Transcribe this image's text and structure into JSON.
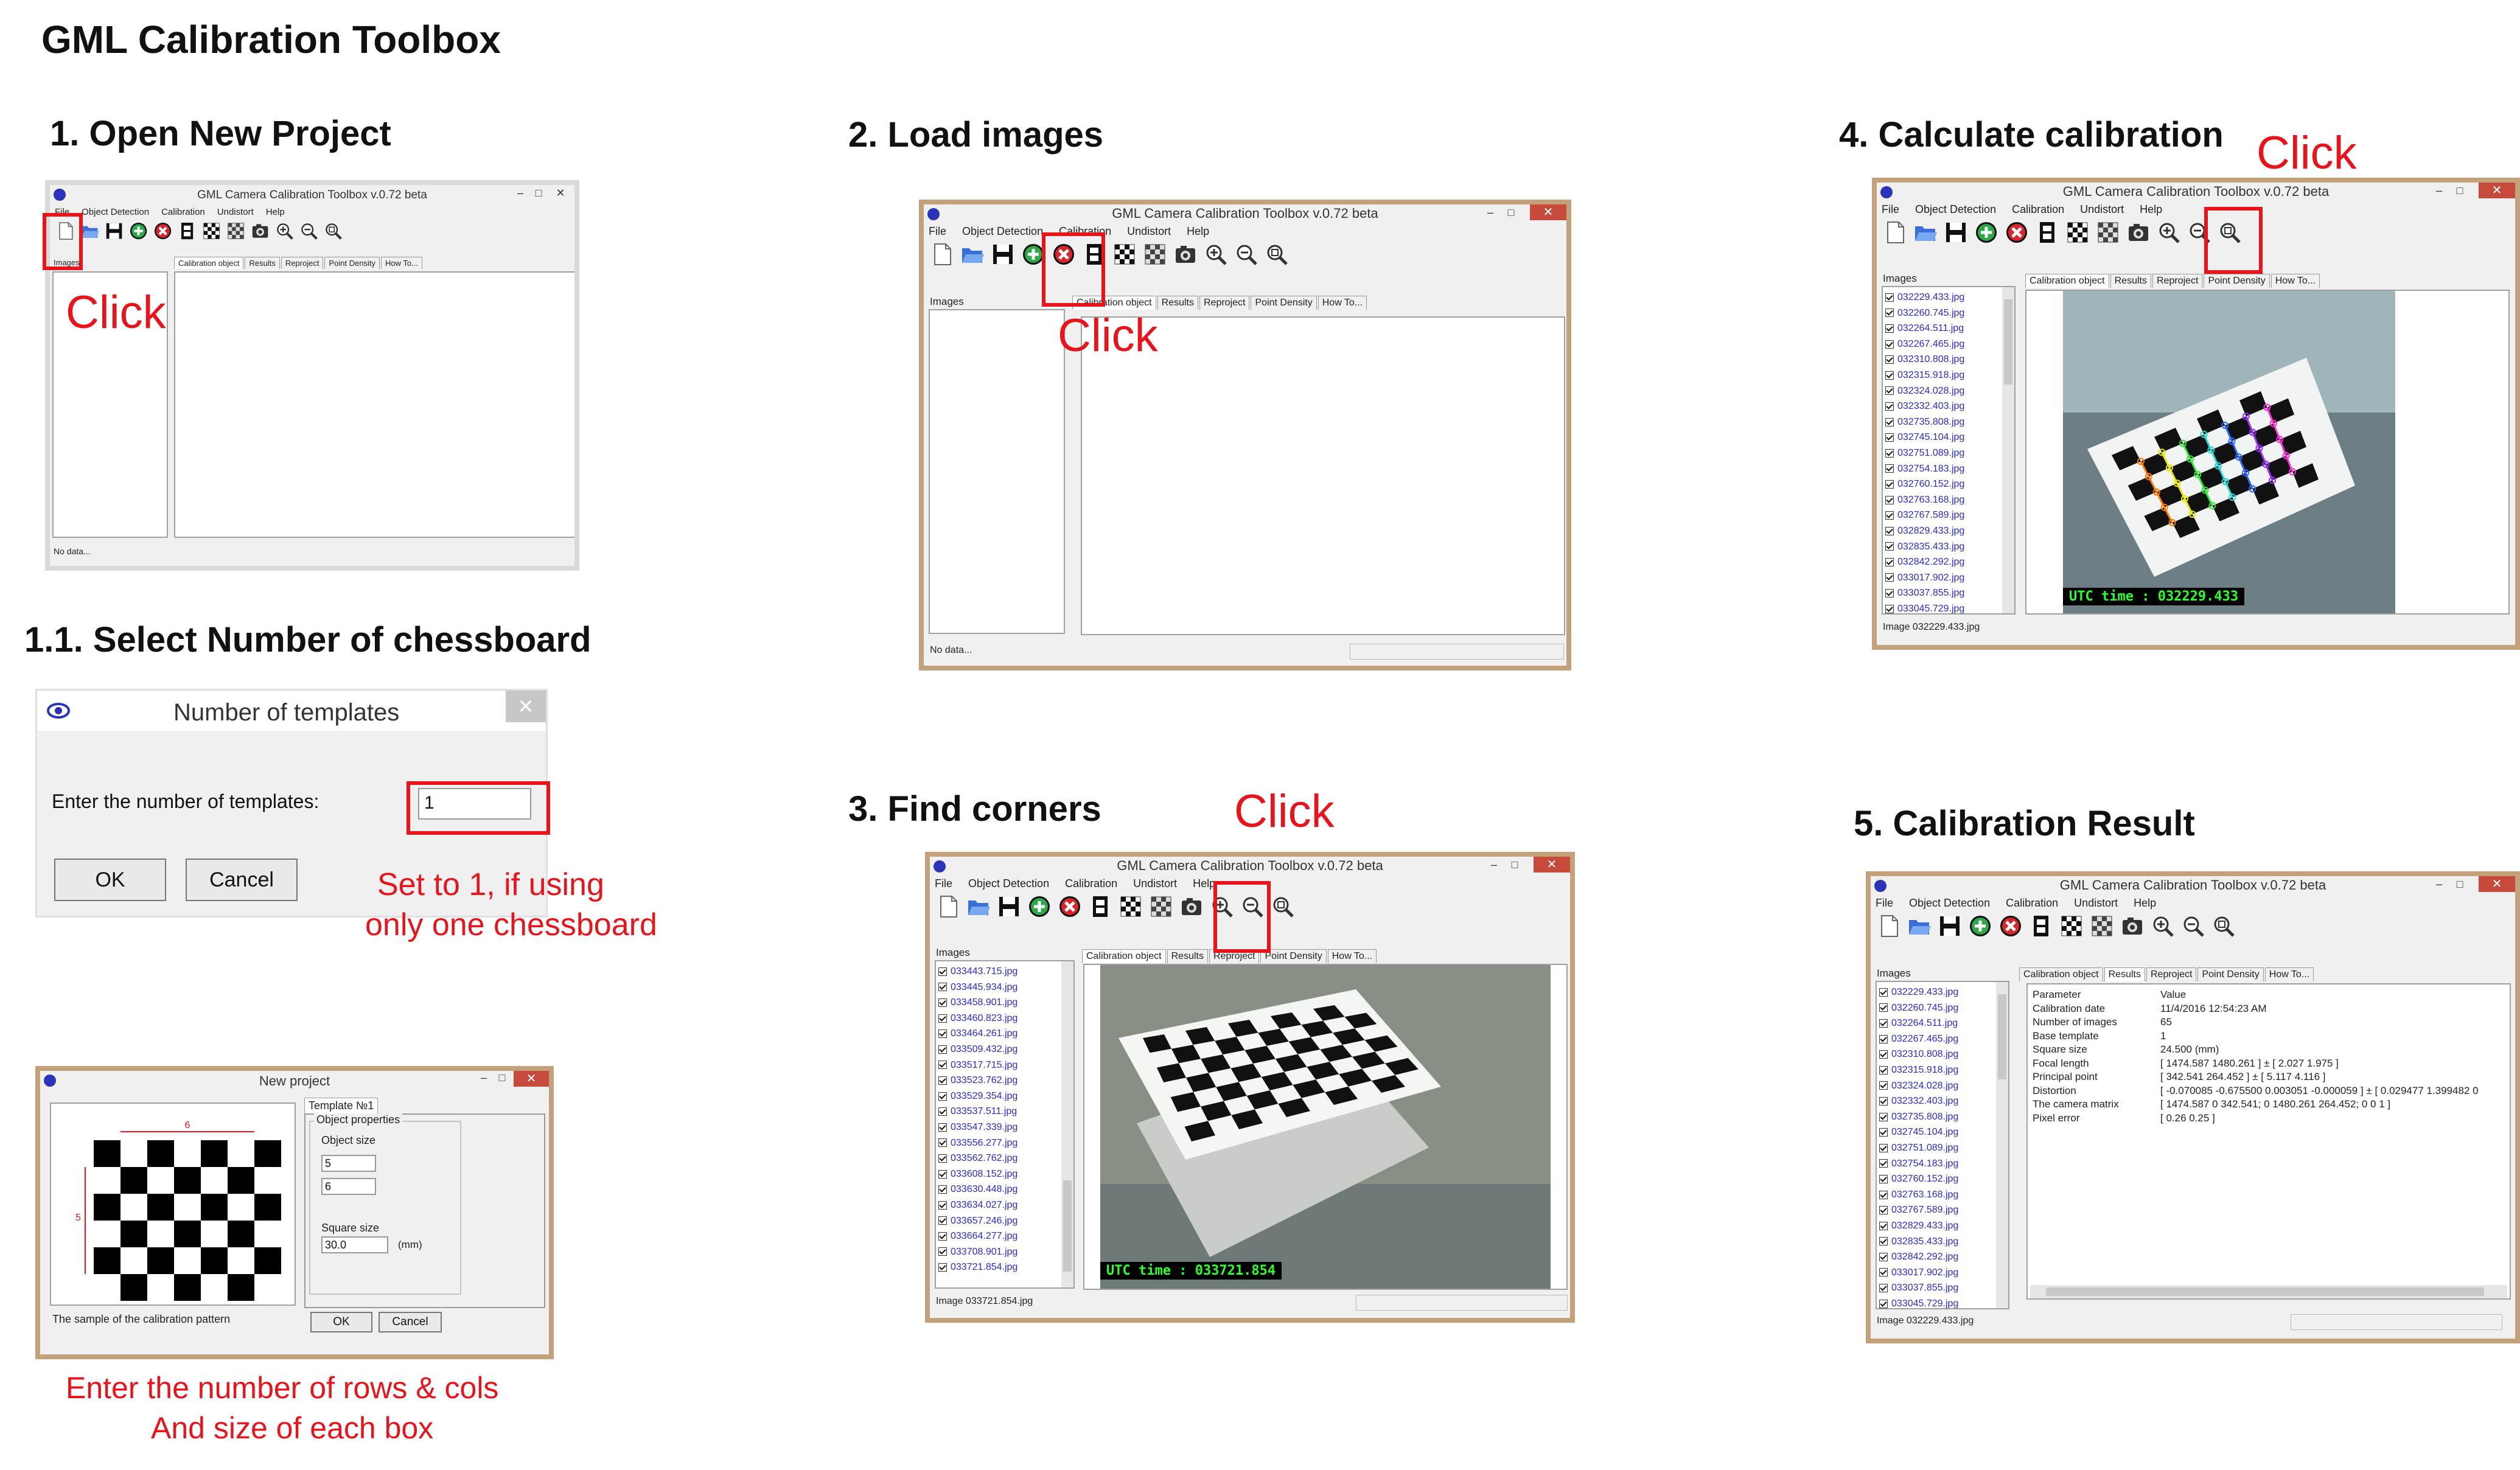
{
  "page_title": "GML Calibration Toolbox",
  "app": {
    "window_title": "GML Camera Calibration Toolbox  v.0.72 beta",
    "menu": [
      "File",
      "Object Detection",
      "Calibration",
      "Undistort",
      "Help"
    ],
    "tabs": [
      "Calibration object",
      "Results",
      "Reproject",
      "Point Density",
      "How To..."
    ],
    "images_label": "Images",
    "no_data": "No data..."
  },
  "toolbar_icons": [
    "new-file-icon",
    "open-folder-icon",
    "save-icon",
    "add-images-icon",
    "remove-images-icon",
    "film-icon",
    "chessboard-icon",
    "detect-corners-icon",
    "camera-calibrate-icon",
    "zoom-in-icon",
    "zoom-out-icon",
    "zoom-fit-icon"
  ],
  "step1": {
    "heading": "1. Open New Project",
    "click": "Click"
  },
  "step1_1": {
    "heading": "1.1. Select Number of chessboard",
    "dialog_title": "Number of templates",
    "prompt": "Enter the number of templates:",
    "value": "1",
    "ok": "OK",
    "cancel": "Cancel",
    "note_line1": "Set to 1, if using",
    "note_line2": "only one chessboard"
  },
  "new_project": {
    "title": "New project",
    "tab": "Template №1",
    "group": "Object properties",
    "object_size_label": "Object size",
    "rows": "5",
    "cols": "6",
    "square_size_label": "Square size",
    "square_size": "30.0",
    "unit": "(mm)",
    "sample_label": "The sample of the calibration pattern",
    "ok": "OK",
    "cancel": "Cancel",
    "dim_top": "6",
    "dim_left": "5",
    "dim_square": "30",
    "note_line1": "Enter the number of rows & cols",
    "note_line2": "And size of each box"
  },
  "step2": {
    "heading": "2. Load images",
    "click": "Click"
  },
  "step3": {
    "heading": "3. Find corners",
    "click": "Click",
    "files": [
      "033443.715.jpg",
      "033445.934.jpg",
      "033458.901.jpg",
      "033460.823.jpg",
      "033464.261.jpg",
      "033509.432.jpg",
      "033517.715.jpg",
      "033523.762.jpg",
      "033529.354.jpg",
      "033537.511.jpg",
      "033547.339.jpg",
      "033556.277.jpg",
      "033562.762.jpg",
      "033608.152.jpg",
      "033630.448.jpg",
      "033634.027.jpg",
      "033657.246.jpg",
      "033664.277.jpg",
      "033708.901.jpg",
      "033721.854.jpg"
    ],
    "utc": "UTC time : 033721.854",
    "status": "Image 033721.854.jpg"
  },
  "step4": {
    "heading": "4. Calculate calibration",
    "click": "Click",
    "files": [
      "032229.433.jpg",
      "032260.745.jpg",
      "032264.511.jpg",
      "032267.465.jpg",
      "032310.808.jpg",
      "032315.918.jpg",
      "032324.028.jpg",
      "032332.403.jpg",
      "032735.808.jpg",
      "032745.104.jpg",
      "032751.089.jpg",
      "032754.183.jpg",
      "032760.152.jpg",
      "032763.168.jpg",
      "032767.589.jpg",
      "032829.433.jpg",
      "032835.433.jpg",
      "032842.292.jpg",
      "033017.902.jpg",
      "033037.855.jpg",
      "033045.729.jpg"
    ],
    "utc": "UTC time : 032229.433",
    "status": "Image 032229.433.jpg"
  },
  "step5": {
    "heading": "5. Calibration Result",
    "files": [
      "032229.433.jpg",
      "032260.745.jpg",
      "032264.511.jpg",
      "032267.465.jpg",
      "032310.808.jpg",
      "032315.918.jpg",
      "032324.028.jpg",
      "032332.403.jpg",
      "032735.808.jpg",
      "032745.104.jpg",
      "032751.089.jpg",
      "032754.183.jpg",
      "032760.152.jpg",
      "032763.168.jpg",
      "032767.589.jpg",
      "032829.433.jpg",
      "032835.433.jpg",
      "032842.292.jpg",
      "033017.902.jpg",
      "033037.855.jpg",
      "033045.729.jpg"
    ],
    "table_header": [
      "Parameter",
      "Value"
    ],
    "rows": [
      [
        "Calibration date",
        "11/4/2016 12:54:23 AM"
      ],
      [
        "Number of images",
        "65"
      ],
      [
        "Base template",
        "1"
      ],
      [
        "Square size",
        "24.500 (mm)"
      ],
      [
        "Focal length",
        "[ 1474.587  1480.261 ] ± [ 2.027  1.975 ]"
      ],
      [
        "Principal point",
        "[ 342.541  264.452 ] ± [ 5.117  4.116 ]"
      ],
      [
        "Distortion",
        "[ -0.070085  -0.675500  0.003051  -0.000059 ] ± [ 0.029477  1.399482  0"
      ],
      [
        "The camera matrix",
        "[ 1474.587  0  342.541;  0  1480.261  264.452;  0  0  1 ]"
      ],
      [
        "Pixel error",
        "[ 0.26  0.25 ]"
      ]
    ],
    "status": "Image 032229.433.jpg"
  }
}
